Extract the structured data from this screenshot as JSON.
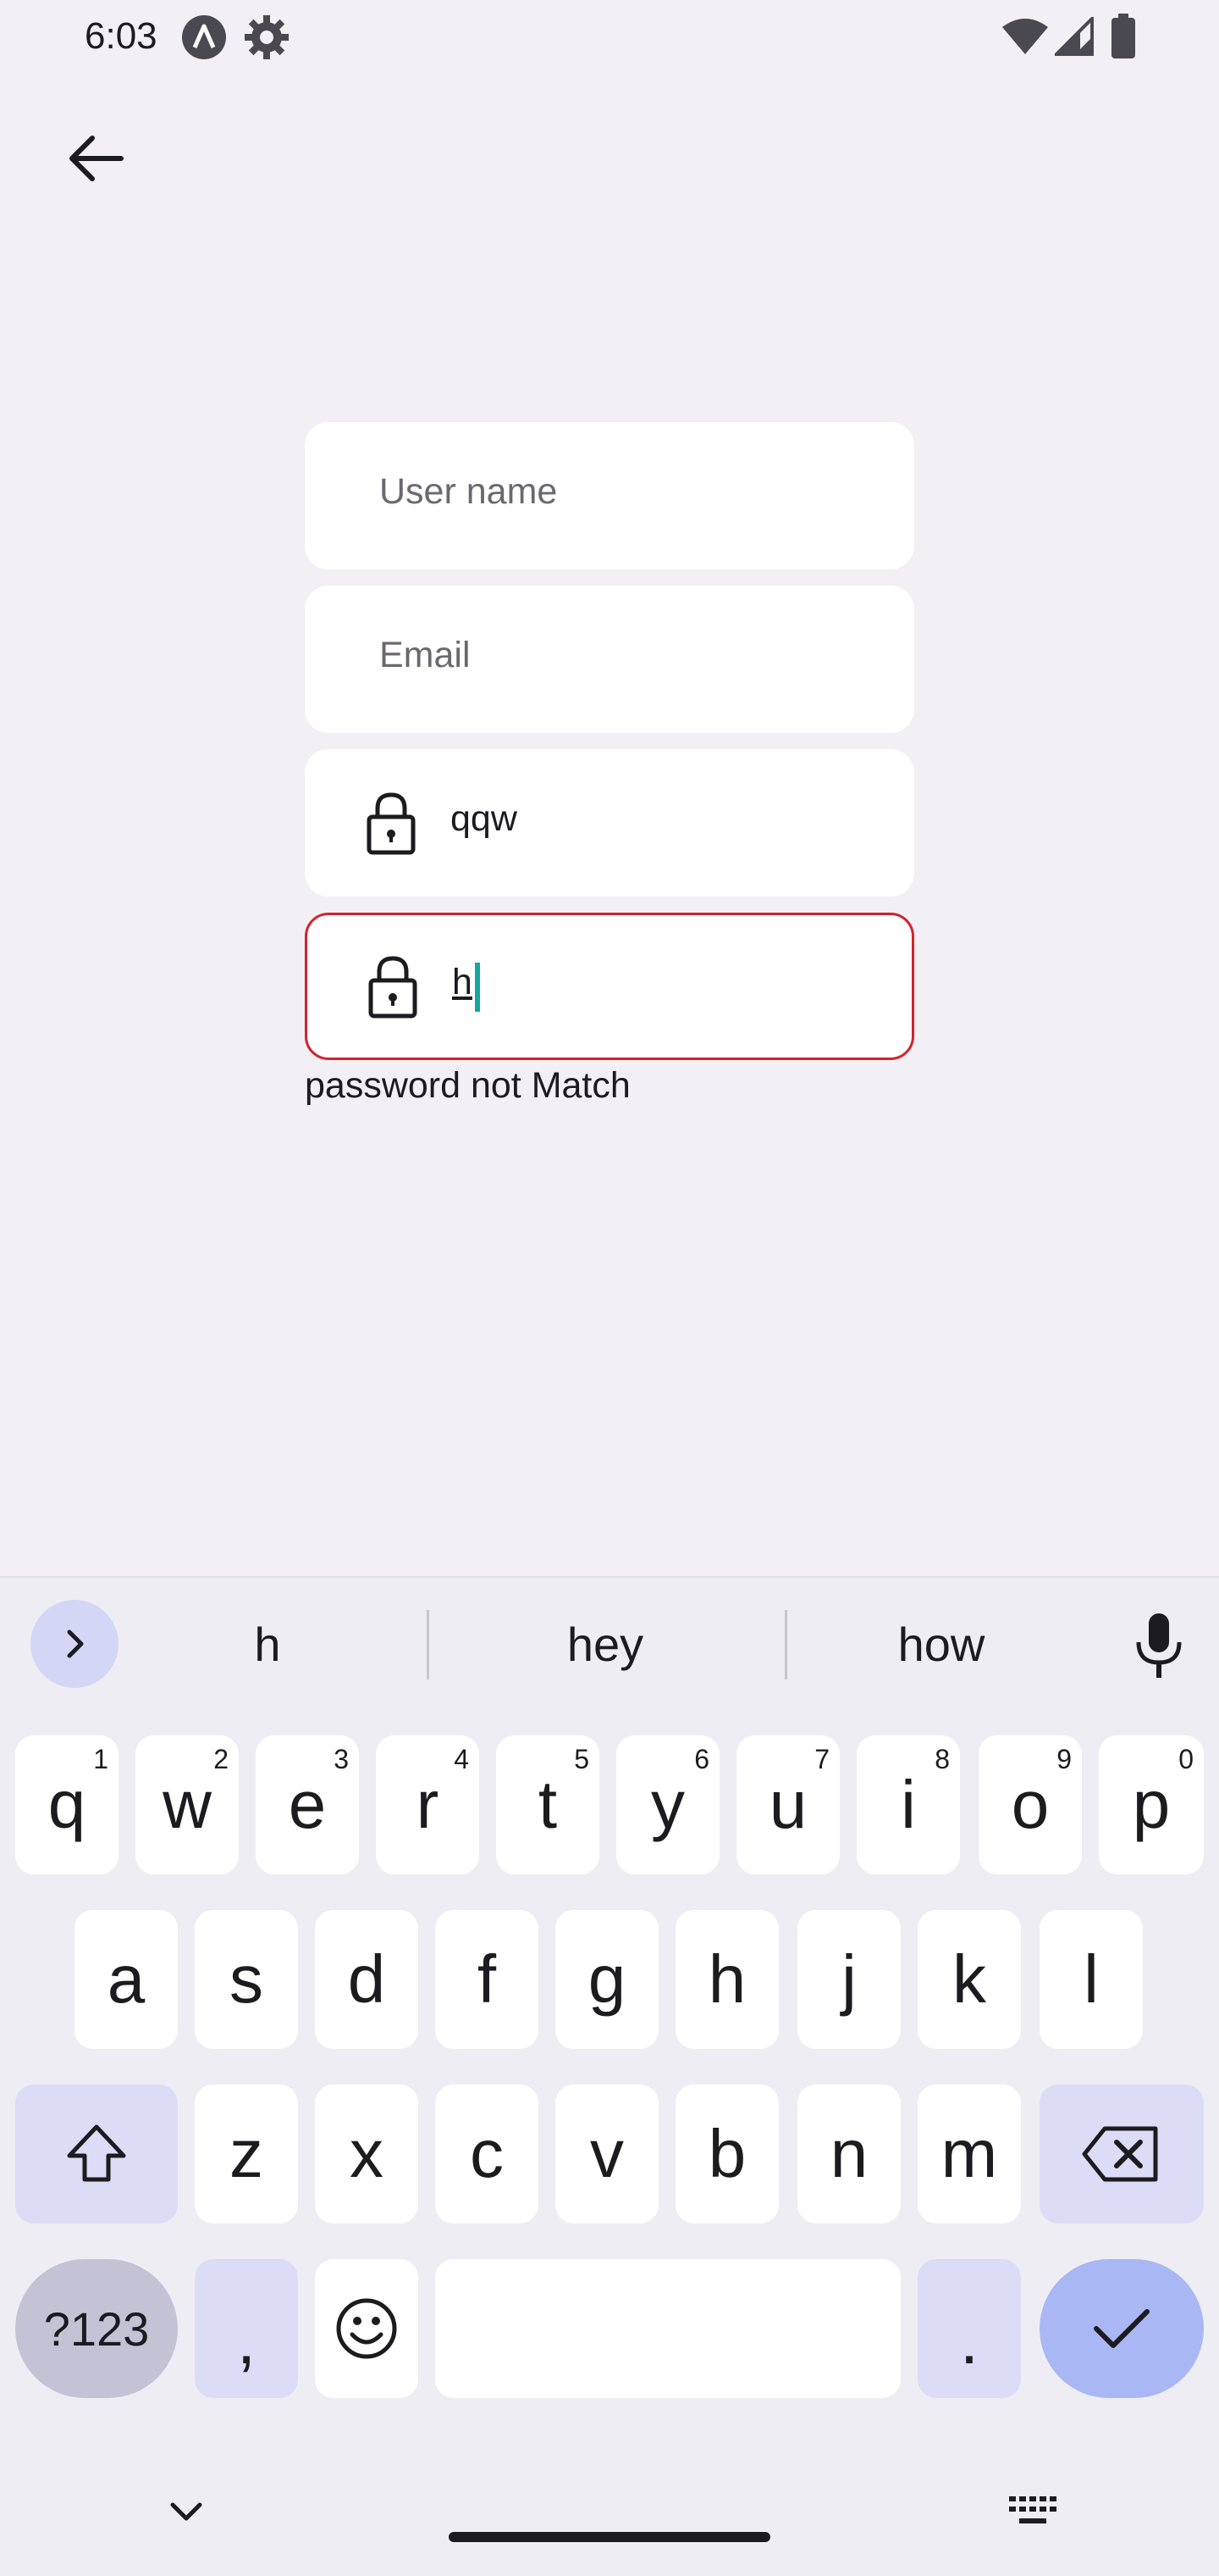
{
  "status_bar": {
    "time": "6:03",
    "icons": [
      "app-a-icon",
      "settings-gear-icon",
      "wifi-icon",
      "cellular-signal-icon",
      "battery-icon"
    ]
  },
  "header": {
    "back_icon": "arrow-left-icon"
  },
  "form": {
    "username": {
      "placeholder": "User name",
      "value": ""
    },
    "email": {
      "placeholder": "Email",
      "value": ""
    },
    "password": {
      "value": "qqw",
      "icon": "lock-icon"
    },
    "confirm_password": {
      "value": "h",
      "icon": "lock-icon",
      "state": "error"
    },
    "error_message": "password not Match"
  },
  "keyboard": {
    "suggestions": [
      "h",
      "hey",
      "how"
    ],
    "row1": [
      {
        "key": "q",
        "hint": "1"
      },
      {
        "key": "w",
        "hint": "2"
      },
      {
        "key": "e",
        "hint": "3"
      },
      {
        "key": "r",
        "hint": "4"
      },
      {
        "key": "t",
        "hint": "5"
      },
      {
        "key": "y",
        "hint": "6"
      },
      {
        "key": "u",
        "hint": "7"
      },
      {
        "key": "i",
        "hint": "8"
      },
      {
        "key": "o",
        "hint": "9"
      },
      {
        "key": "p",
        "hint": "0"
      }
    ],
    "row2": [
      "a",
      "s",
      "d",
      "f",
      "g",
      "h",
      "j",
      "k",
      "l"
    ],
    "row3": [
      "z",
      "x",
      "c",
      "v",
      "b",
      "n",
      "m"
    ],
    "row4": {
      "symbols": "?123",
      "comma": ",",
      "period": "."
    },
    "colors": {
      "function_key": "#dcdcf6",
      "enter_key": "#a9b8f4",
      "error": "#d3222c",
      "caret": "#13a8a0"
    }
  }
}
